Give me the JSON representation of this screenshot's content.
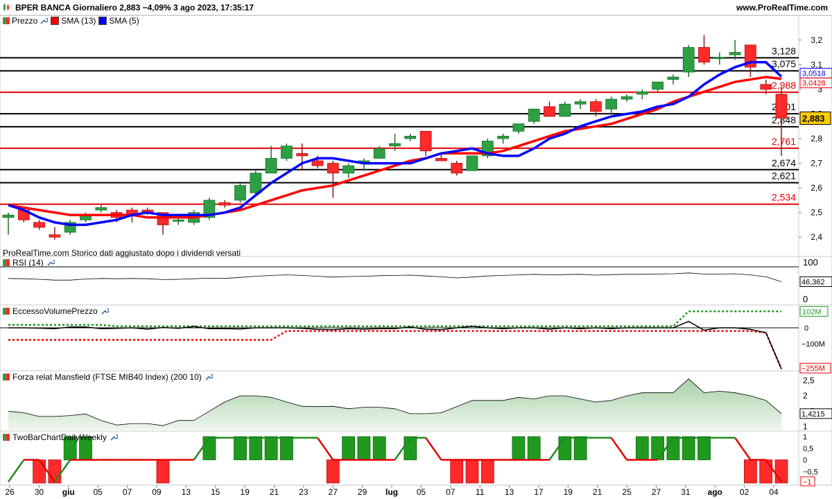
{
  "header": {
    "title": "BPER BANCA Giornaliero 2,883 −4,09% 3 ago 2023, 17:35:17",
    "site": "www.ProRealTime.com"
  },
  "note": "ProRealTime.com  Storico dati aggiustato dopo i dividendi versati",
  "chart_data": [
    {
      "type": "candlestick",
      "title": "Prezzo",
      "legend": [
        "Prezzo",
        "SMA (13)",
        "SMA (5)"
      ],
      "colors": {
        "up": "#2ea043",
        "down": "#ff2a2a",
        "sma13": "#ff0000",
        "sma5": "#0000ff"
      },
      "x_tick_labels": [
        "26",
        "30",
        "giu",
        "05",
        "07",
        "09",
        "13",
        "15",
        "19",
        "21",
        "23",
        "27",
        "29",
        "lug",
        "05",
        "07",
        "11",
        "13",
        "17",
        "19",
        "21",
        "25",
        "27",
        "31",
        "ago",
        "02",
        "04"
      ],
      "y_range": [
        2.35,
        3.25
      ],
      "y_ticks": [
        "3,2",
        "3,1",
        "3",
        "2,9",
        "2,8",
        "2,7",
        "2,6",
        "2,5",
        "2,4"
      ],
      "ohlc": [
        [
          2.48,
          2.5,
          2.41,
          2.49
        ],
        [
          2.51,
          2.52,
          2.46,
          2.47
        ],
        [
          2.46,
          2.47,
          2.43,
          2.44
        ],
        [
          2.41,
          2.44,
          2.39,
          2.4
        ],
        [
          2.42,
          2.47,
          2.41,
          2.46
        ],
        [
          2.47,
          2.5,
          2.46,
          2.49
        ],
        [
          2.51,
          2.53,
          2.5,
          2.52
        ],
        [
          2.5,
          2.51,
          2.46,
          2.48
        ],
        [
          2.51,
          2.52,
          2.46,
          2.49
        ],
        [
          2.51,
          2.52,
          2.49,
          2.5
        ],
        [
          2.5,
          2.5,
          2.41,
          2.45
        ],
        [
          2.47,
          2.48,
          2.45,
          2.47
        ],
        [
          2.46,
          2.51,
          2.45,
          2.5
        ],
        [
          2.48,
          2.56,
          2.47,
          2.55
        ],
        [
          2.54,
          2.55,
          2.52,
          2.53
        ],
        [
          2.55,
          2.62,
          2.54,
          2.61
        ],
        [
          2.58,
          2.67,
          2.57,
          2.66
        ],
        [
          2.66,
          2.77,
          2.66,
          2.72
        ],
        [
          2.72,
          2.78,
          2.71,
          2.77
        ],
        [
          2.74,
          2.78,
          2.67,
          2.73
        ],
        [
          2.71,
          2.73,
          2.68,
          2.69
        ],
        [
          2.7,
          2.71,
          2.56,
          2.66
        ],
        [
          2.66,
          2.7,
          2.64,
          2.69
        ],
        [
          2.71,
          2.72,
          2.67,
          2.71
        ],
        [
          2.72,
          2.77,
          2.72,
          2.76
        ],
        [
          2.77,
          2.82,
          2.75,
          2.78
        ],
        [
          2.8,
          2.82,
          2.79,
          2.81
        ],
        [
          2.83,
          2.83,
          2.73,
          2.75
        ],
        [
          2.72,
          2.74,
          2.71,
          2.71
        ],
        [
          2.7,
          2.71,
          2.65,
          2.66
        ],
        [
          2.67,
          2.73,
          2.67,
          2.73
        ],
        [
          2.73,
          2.8,
          2.72,
          2.79
        ],
        [
          2.8,
          2.82,
          2.78,
          2.81
        ],
        [
          2.83,
          2.86,
          2.82,
          2.86
        ],
        [
          2.87,
          2.92,
          2.86,
          2.92
        ],
        [
          2.93,
          2.95,
          2.89,
          2.89
        ],
        [
          2.89,
          2.95,
          2.89,
          2.94
        ],
        [
          2.94,
          2.96,
          2.92,
          2.95
        ],
        [
          2.95,
          2.96,
          2.89,
          2.91
        ],
        [
          2.92,
          2.97,
          2.9,
          2.96
        ],
        [
          2.96,
          2.98,
          2.95,
          2.97
        ],
        [
          2.98,
          3.0,
          2.96,
          2.99
        ],
        [
          3.0,
          3.03,
          2.99,
          3.03
        ],
        [
          3.04,
          3.06,
          3.02,
          3.05
        ],
        [
          3.07,
          3.18,
          3.05,
          3.17
        ],
        [
          3.17,
          3.22,
          3.1,
          3.11
        ],
        [
          3.13,
          3.15,
          3.1,
          3.13
        ],
        [
          3.14,
          3.2,
          3.12,
          3.15
        ],
        [
          3.18,
          3.18,
          3.05,
          3.09
        ],
        [
          3.02,
          3.04,
          2.98,
          3.0
        ],
        [
          2.98,
          3.01,
          2.73,
          2.883
        ]
      ],
      "sma13": [
        2.53,
        2.52,
        2.51,
        2.5,
        2.49,
        2.49,
        2.49,
        2.49,
        2.49,
        2.48,
        2.48,
        2.48,
        2.48,
        2.49,
        2.5,
        2.51,
        2.53,
        2.55,
        2.57,
        2.59,
        2.6,
        2.61,
        2.63,
        2.65,
        2.67,
        2.69,
        2.71,
        2.72,
        2.74,
        2.74,
        2.74,
        2.74,
        2.75,
        2.77,
        2.79,
        2.81,
        2.83,
        2.84,
        2.85,
        2.86,
        2.88,
        2.9,
        2.92,
        2.95,
        2.97,
        2.99,
        3.01,
        3.03,
        3.04,
        3.05,
        3.0428
      ],
      "sma5": [
        2.53,
        2.51,
        2.48,
        2.46,
        2.45,
        2.45,
        2.46,
        2.47,
        2.49,
        2.5,
        2.49,
        2.49,
        2.49,
        2.49,
        2.5,
        2.52,
        2.57,
        2.62,
        2.66,
        2.7,
        2.72,
        2.72,
        2.71,
        2.7,
        2.7,
        2.7,
        2.7,
        2.72,
        2.74,
        2.75,
        2.76,
        2.74,
        2.73,
        2.73,
        2.76,
        2.8,
        2.82,
        2.85,
        2.87,
        2.89,
        2.9,
        2.91,
        2.93,
        2.94,
        2.97,
        3.02,
        3.06,
        3.09,
        3.11,
        3.11,
        3.0518
      ],
      "horizontal_levels": [
        {
          "value": 3.128,
          "label": "3,128",
          "color": "#000000"
        },
        {
          "value": 3.075,
          "label": "3,075",
          "color": "#000000"
        },
        {
          "value": 2.988,
          "label": "2,988",
          "color": "#e60000"
        },
        {
          "value": 2.901,
          "label": "2,901",
          "color": "#000000"
        },
        {
          "value": 2.848,
          "label": "2,848",
          "color": "#000000"
        },
        {
          "value": 2.761,
          "label": "2,761",
          "color": "#e60000"
        },
        {
          "value": 2.674,
          "label": "2,674",
          "color": "#000000"
        },
        {
          "value": 2.621,
          "label": "2,621",
          "color": "#000000"
        },
        {
          "value": 2.534,
          "label": "2,534",
          "color": "#e60000"
        }
      ],
      "last_value_labels": [
        {
          "label": "3,0518",
          "color": "#0000ff",
          "bg": "#ffffff"
        },
        {
          "label": "3,0428",
          "color": "#e60000",
          "bg": "#ffffff"
        },
        {
          "label": "2,883",
          "color": "#000000",
          "bg": "#ffcc00"
        }
      ]
    },
    {
      "type": "line",
      "title": "RSI (14)",
      "y_ticks": [
        "100",
        "0"
      ],
      "y_range": [
        0,
        100
      ],
      "last_label": "46,362",
      "values": [
        58,
        57,
        55,
        52,
        52,
        56,
        58,
        57,
        58,
        57,
        54,
        55,
        57,
        59,
        58,
        62,
        66,
        69,
        71,
        69,
        66,
        63,
        65,
        66,
        68,
        69,
        70,
        67,
        64,
        60,
        63,
        67,
        69,
        71,
        73,
        71,
        72,
        73,
        70,
        72,
        73,
        73,
        74,
        75,
        78,
        74,
        74,
        75,
        71,
        64,
        46.362
      ]
    },
    {
      "type": "line",
      "title": "EccessoVolumePrezzo",
      "y_ticks": [
        "0",
        "−100M"
      ],
      "labels": [
        "102M",
        "−255M"
      ],
      "price_line": [
        0,
        0,
        -2,
        -5,
        5,
        5,
        -5,
        -3,
        0,
        -8,
        2,
        -3,
        8,
        -5,
        -5,
        -7,
        0,
        0,
        0,
        -3,
        -10,
        -12,
        -5,
        -8,
        -5,
        -5,
        5,
        -10,
        -12,
        0,
        10,
        0,
        -5,
        0,
        0,
        -8,
        0,
        -5,
        0,
        -5,
        0,
        0,
        0,
        0,
        40,
        -15,
        0,
        0,
        -10,
        -30,
        -255
      ],
      "upper_dotted": [
        18,
        18,
        18,
        18,
        18,
        18,
        18,
        10,
        10,
        10,
        10,
        10,
        10,
        10,
        10,
        10,
        10,
        10,
        10,
        10,
        10,
        10,
        10,
        10,
        10,
        10,
        10,
        10,
        10,
        10,
        10,
        10,
        10,
        10,
        10,
        10,
        10,
        10,
        10,
        10,
        10,
        10,
        10,
        10,
        102,
        102,
        102,
        102,
        102,
        102,
        102
      ],
      "lower_dotted": [
        -75,
        -75,
        -75,
        -75,
        -75,
        -75,
        -75,
        -75,
        -75,
        -75,
        -75,
        -75,
        -75,
        -75,
        -75,
        -75,
        -75,
        -75,
        -20,
        -20,
        -20,
        -20,
        -20,
        -20,
        -20,
        -20,
        -20,
        -20,
        -20,
        -20,
        -20,
        -20,
        -20,
        -20,
        -20,
        -20,
        -20,
        -20,
        -20,
        -20,
        -20,
        -20,
        -20,
        -20,
        -20,
        -20,
        -20,
        -20,
        -20,
        -30,
        -255
      ],
      "colors": {
        "price": "#000000",
        "upper": "#1a9a1a",
        "lower": "#e60000"
      }
    },
    {
      "type": "area",
      "title": "Forza relat Mansfield (FTSE MIB40 Index) (200 10)",
      "y_ticks": [
        "2,5",
        "2",
        "1,5",
        "1"
      ],
      "y_range": [
        0.9,
        2.7
      ],
      "last_label": "1,4215",
      "values": [
        1.5,
        1.45,
        1.33,
        1.33,
        1.36,
        1.41,
        1.2,
        1.05,
        1.1,
        1.1,
        1.03,
        1.2,
        1.2,
        1.5,
        1.8,
        2.0,
        2.0,
        1.95,
        1.8,
        1.66,
        1.65,
        1.66,
        1.58,
        1.63,
        1.63,
        1.58,
        1.42,
        1.42,
        1.45,
        1.65,
        1.85,
        1.85,
        1.85,
        1.95,
        1.9,
        2.0,
        2.0,
        1.9,
        1.8,
        1.85,
        2.0,
        2.1,
        2.1,
        2.1,
        2.55,
        2.1,
        2.15,
        2.1,
        2.0,
        1.85,
        1.4215
      ]
    },
    {
      "type": "bar",
      "title": "TwoBarChartDailyWeekly",
      "y_ticks": [
        "1",
        "0,5",
        "0",
        "−0,5",
        "−1"
      ],
      "y_range": [
        -1,
        1
      ],
      "colors": {
        "bull": "#1f9a1f",
        "bear": "#ff2a2a",
        "line_up": "#1f8a1f",
        "line_down": "#e60000"
      },
      "bars": [
        0,
        0,
        -1,
        -1,
        1,
        1,
        0,
        0,
        0,
        0,
        -1,
        0,
        0,
        1,
        0,
        1,
        1,
        1,
        1,
        0,
        0,
        -1,
        1,
        1,
        1,
        0,
        1,
        0,
        0,
        -1,
        -1,
        -1,
        0,
        1,
        1,
        0,
        1,
        1,
        0,
        0,
        0,
        1,
        1,
        1,
        1,
        1,
        0,
        0,
        -1,
        -1,
        -1
      ],
      "line": [
        -1,
        0,
        0,
        -1,
        0,
        0,
        0,
        0,
        0,
        0,
        0,
        0,
        0,
        1,
        1,
        1,
        1,
        1,
        1,
        1,
        1,
        0,
        0,
        0,
        0,
        0,
        1,
        1,
        0,
        0,
        0,
        0,
        0,
        0,
        0,
        0,
        1,
        1,
        1,
        1,
        0,
        0,
        0,
        1,
        1,
        1,
        1,
        1,
        0,
        0,
        -1
      ]
    }
  ]
}
